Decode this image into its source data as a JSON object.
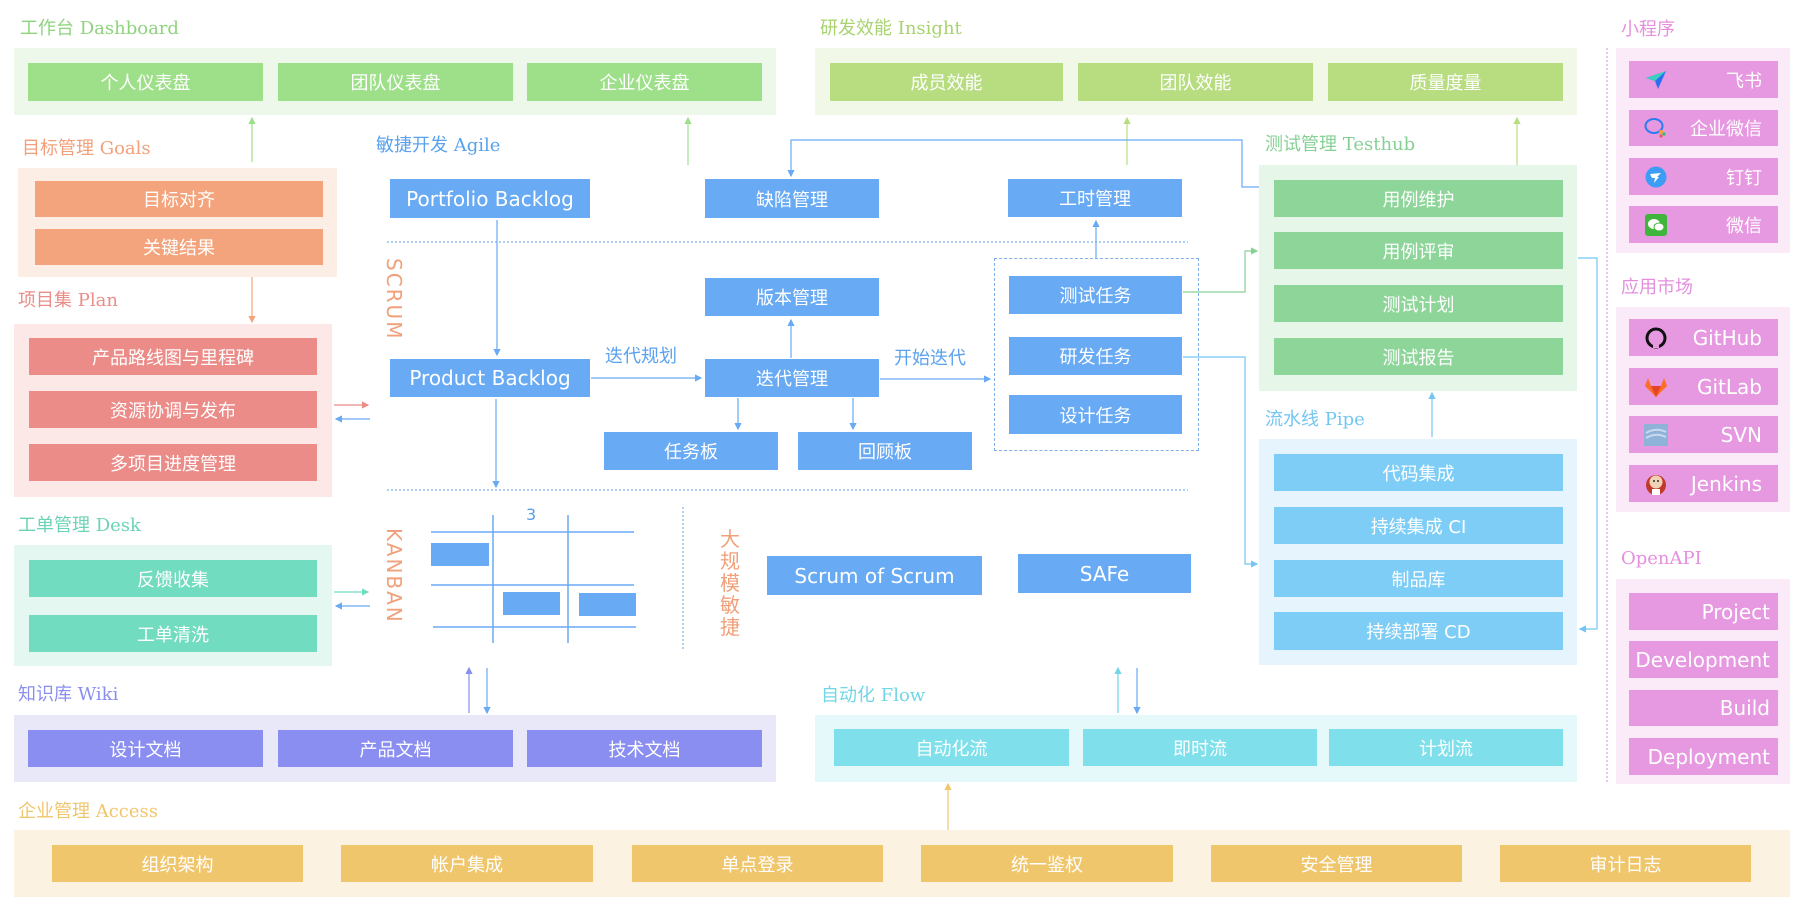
{
  "colors": {
    "dashboard": "#9ee08a",
    "dashboard_bg": "#edf8ea",
    "dashboard_title": "#8ed47e",
    "insight": "#b7dd80",
    "insight_bg": "#f1f8e8",
    "insight_title": "#a8d36e",
    "goals": "#f3a47c",
    "goals_bg": "#fcede5",
    "goals_title": "#f3a07a",
    "plan": "#eb8c88",
    "plan_bg": "#fbe8e7",
    "plan_title": "#eb8c88",
    "desk": "#72dcc0",
    "desk_bg": "#e4f7f1",
    "desk_title": "#6cd3b6",
    "wiki": "#8a8ef0",
    "wiki_bg": "#e8e8f9",
    "wiki_title": "#8a8ef0",
    "access": "#f0c66c",
    "access_bg": "#fbf2e2",
    "access_title": "#f0c66c",
    "agile": "#68aaf3",
    "agile_bg": "#e1eefb",
    "agile_title": "#5aa2ee",
    "testhub": "#8ed59a",
    "testhub_bg": "#e6f6e9",
    "testhub_title": "#86d096",
    "pipe": "#7dcdf6",
    "pipe_bg": "#e6f4fd",
    "pipe_title": "#72c6f2",
    "flow": "#7fdfeb",
    "flow_bg": "#e5f8fa",
    "flow_title": "#72d6e6",
    "apps": "#e699e0",
    "apps_bg": "#fbebf8",
    "apps_title": "#e48fde",
    "label_orange": "#f0a07a"
  },
  "dashboard": {
    "title": "工作台 Dashboard",
    "items": [
      "个人仪表盘",
      "团队仪表盘",
      "企业仪表盘"
    ]
  },
  "insight": {
    "title": "研发效能 Insight",
    "items": [
      "成员效能",
      "团队效能",
      "质量度量"
    ]
  },
  "goals": {
    "title": "目标管理 Goals",
    "items": [
      "目标对齐",
      "关键结果"
    ]
  },
  "plan": {
    "title": "项目集 Plan",
    "items": [
      "产品路线图与里程碑",
      "资源协调与发布",
      "多项目进度管理"
    ]
  },
  "desk": {
    "title": "工单管理 Desk",
    "items": [
      "反馈收集",
      "工单清洗"
    ]
  },
  "wiki": {
    "title": "知识库 Wiki",
    "items": [
      "设计文档",
      "产品文档",
      "技术文档"
    ]
  },
  "access": {
    "title": "企业管理 Access",
    "items": [
      "组织架构",
      "帐户集成",
      "单点登录",
      "统一鉴权",
      "安全管理",
      "审计日志"
    ]
  },
  "agile": {
    "title": "敏捷开发 Agile",
    "scrum_label": "SCRUM",
    "kanban_label": "KANBAN",
    "scale_label": [
      "大",
      "规",
      "模",
      "敏",
      "捷"
    ],
    "portfolio_backlog": "Portfolio Backlog",
    "defect_mgmt": "缺陷管理",
    "worklog_mgmt": "工时管理",
    "version_mgmt": "版本管理",
    "product_backlog": "Product Backlog",
    "iteration_planning": "迭代规划",
    "iteration_mgmt": "迭代管理",
    "start_iteration": "开始迭代",
    "test_task": "测试任务",
    "dev_task": "研发任务",
    "design_task": "设计任务",
    "task_board": "任务板",
    "retro_board": "回顾板",
    "kanban_wip": "3",
    "scrum_of_scrum": "Scrum of Scrum",
    "safe": "SAFe"
  },
  "testhub": {
    "title": "测试管理 Testhub",
    "items": [
      "用例维护",
      "用例评审",
      "测试计划",
      "测试报告"
    ]
  },
  "pipe": {
    "title": "流水线 Pipe",
    "items": [
      "代码集成",
      "持续集成 CI",
      "制品库",
      "持续部署 CD"
    ]
  },
  "flow": {
    "title": "自动化 Flow",
    "items": [
      "自动化流",
      "即时流",
      "计划流"
    ]
  },
  "miniprogram": {
    "title": "小程序",
    "items": [
      {
        "label": "飞书",
        "icon": "feishu-icon"
      },
      {
        "label": "企业微信",
        "icon": "wecom-icon"
      },
      {
        "label": "钉钉",
        "icon": "dingtalk-icon"
      },
      {
        "label": "微信",
        "icon": "wechat-icon"
      }
    ]
  },
  "marketplace": {
    "title": "应用市场",
    "items": [
      {
        "label": "GitHub",
        "icon": "github-icon"
      },
      {
        "label": "GitLab",
        "icon": "gitlab-icon"
      },
      {
        "label": "SVN",
        "icon": "svn-icon"
      },
      {
        "label": "Jenkins",
        "icon": "jenkins-icon"
      }
    ]
  },
  "openapi": {
    "title": "OpenAPI",
    "items": [
      "Project",
      "Development",
      "Build",
      "Deployment"
    ]
  }
}
